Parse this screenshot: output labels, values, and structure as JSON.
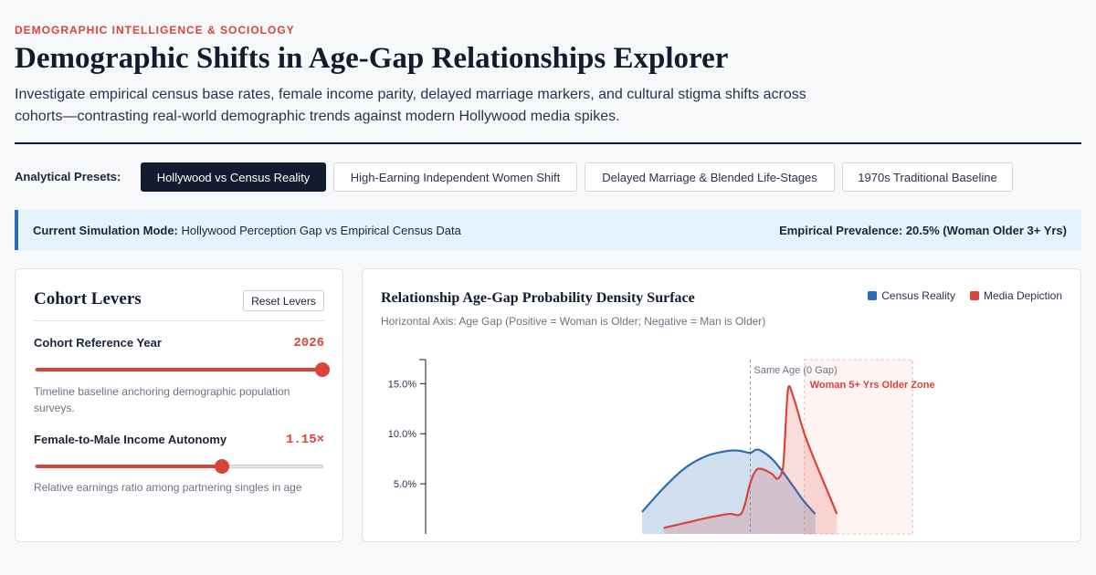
{
  "header": {
    "eyebrow": "DEMOGRAPHIC INTELLIGENCE & SOCIOLOGY",
    "title": "Demographic Shifts in Age-Gap Relationships Explorer",
    "subtitle": "Investigate empirical census base rates, female income parity, delayed marriage markers, and cultural stigma shifts across cohorts—contrasting real-world demographic trends against modern Hollywood media spikes."
  },
  "presets": {
    "label": "Analytical Presets:",
    "items": [
      {
        "label": "Hollywood vs Census Reality",
        "active": true
      },
      {
        "label": "High-Earning Independent Women Shift",
        "active": false
      },
      {
        "label": "Delayed Marriage & Blended Life-Stages",
        "active": false
      },
      {
        "label": "1970s Traditional Baseline",
        "active": false
      }
    ]
  },
  "mode_bar": {
    "mode_label": "Current Simulation Mode:",
    "mode_value": "Hollywood Perception Gap vs Empirical Census Data",
    "prevalence": "Empirical Prevalence: 20.5% (Woman Older 3+ Yrs)"
  },
  "levers": {
    "title": "Cohort Levers",
    "reset_label": "Reset Levers",
    "items": [
      {
        "label": "Cohort Reference Year",
        "value": "2026",
        "fraction": 1.0,
        "desc": "Timeline baseline anchoring demographic population surveys."
      },
      {
        "label": "Female-to-Male Income Autonomy",
        "value": "1.15×",
        "fraction": 0.65,
        "desc": "Relative earnings ratio among partnering singles in age"
      }
    ]
  },
  "chart_header": {
    "title": "Relationship Age-Gap Probability Density Surface",
    "subtitle": "Horizontal Axis: Age Gap (Positive = Woman is Older; Negative = Man is Older)",
    "legend": [
      {
        "name": "Census Reality",
        "color": "#2a6cb3"
      },
      {
        "name": "Media Depiction",
        "color": "#d9433b"
      }
    ]
  },
  "chart_data": {
    "type": "area",
    "y_ticks": [
      "5.0%",
      "10.0%",
      "15.0%"
    ],
    "y_tick_values": [
      5,
      10,
      15
    ],
    "ylim": [
      0,
      17.4
    ],
    "xlim": [
      -30,
      30
    ],
    "annotations": [
      {
        "text": "Same Age (0 Gap)",
        "x": 0
      },
      {
        "text": "Woman 5+ Yrs Older Zone",
        "x_start": 5,
        "x_end": 15
      }
    ],
    "series": [
      {
        "name": "Census Reality",
        "color": "#2a6cb3",
        "x": [
          -10,
          -8,
          -6,
          -4,
          -2,
          -1,
          0,
          0.5,
          1,
          2,
          3,
          4,
          5,
          6
        ],
        "y": [
          2.2,
          4.6,
          6.6,
          7.8,
          8.3,
          8.3,
          8.1,
          8.4,
          8.3,
          7.5,
          6.2,
          4.7,
          3.2,
          2.0
        ]
      },
      {
        "name": "Media Depiction",
        "color": "#d9433b",
        "x": [
          -8,
          -6,
          -4,
          -2,
          -0.8,
          0,
          0.5,
          1,
          2,
          2.5,
          3,
          3.2,
          3.5,
          4,
          5,
          6,
          7,
          8
        ],
        "y": [
          0.6,
          1.1,
          1.6,
          2.0,
          2.1,
          5.1,
          6.3,
          6.5,
          6.0,
          5.5,
          6.5,
          9.5,
          14.5,
          13.6,
          10.0,
          7.2,
          4.6,
          2.0
        ]
      }
    ]
  }
}
